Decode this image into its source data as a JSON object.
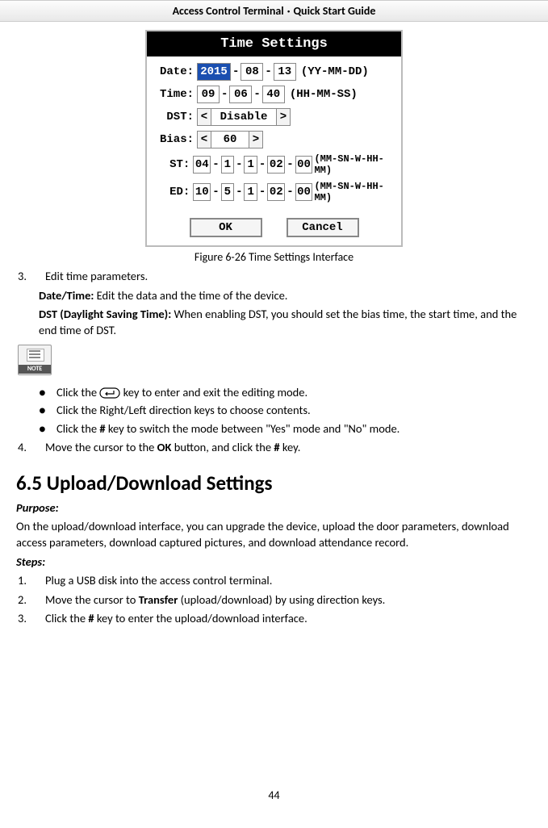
{
  "header": {
    "left": "Access Control Terminal",
    "sep": "·",
    "right": "Quick Start Guide"
  },
  "panel": {
    "title": "Time Settings",
    "dateLabel": "Date:",
    "date": {
      "yy": "2015",
      "mm": "08",
      "dd": "13",
      "fmt": "(YY-MM-DD)"
    },
    "timeLabel": "Time:",
    "time": {
      "hh": "09",
      "mm": "06",
      "ss": "40",
      "fmt": "(HH-MM-SS)"
    },
    "dstLabel": "DST:",
    "dst": "Disable",
    "biasLabel": "Bias:",
    "bias": "60",
    "stLabel": "ST:",
    "st": {
      "a": "04",
      "b": "1",
      "c": "1",
      "d": "02",
      "e": "00",
      "fmt": "(MM-SN-W-HH-MM)"
    },
    "edLabel": "ED:",
    "ed": {
      "a": "10",
      "b": "5",
      "c": "1",
      "d": "02",
      "e": "00",
      "fmt": "(MM-SN-W-HH-MM)"
    },
    "ok": "OK",
    "cancel": "Cancel"
  },
  "caption": "Figure 6-26 Time Settings Interface",
  "step3": {
    "num": "3.",
    "text": "Edit time parameters."
  },
  "dt": {
    "label": "Date/Time:",
    "text": " Edit the data and the time of the device."
  },
  "dst": {
    "label": "DST (Daylight Saving Time):",
    "text": " When enabling DST, you should set the bias time, the start time, and the end time of DST."
  },
  "noteLabel": "NOTE",
  "b1a": "Click the ",
  "b1b": " key to enter and exit the editing mode.",
  "b2": "Click the Right/Left direction keys to choose contents.",
  "b3a": "Click the ",
  "b3hash": "#",
  "b3b": " key to switch the mode between \"Yes\" mode and \"No\" mode.",
  "step4": {
    "num": "4.",
    "a": "Move the cursor to the ",
    "ok": "OK",
    "b": " button, and click the ",
    "hash": "#",
    "c": " key."
  },
  "sectionTitle": "6.5 Upload/Download Settings",
  "purposeLabel": "Purpose:",
  "purpose": "On the upload/download interface, you can upgrade the device, upload the door parameters, download access parameters, download captured pictures, and download attendance record.",
  "stepsLabel": "Steps:",
  "s1": {
    "num": "1.",
    "text": "Plug a USB disk into the access control terminal."
  },
  "s2": {
    "num": "2.",
    "a": "Move the cursor to ",
    "bold": "Transfer",
    "b": " (upload/download) by using direction keys."
  },
  "s3": {
    "num": "3.",
    "a": "Click the ",
    "hash": "#",
    "b": " key to enter the upload/download interface."
  },
  "pageNum": "44"
}
